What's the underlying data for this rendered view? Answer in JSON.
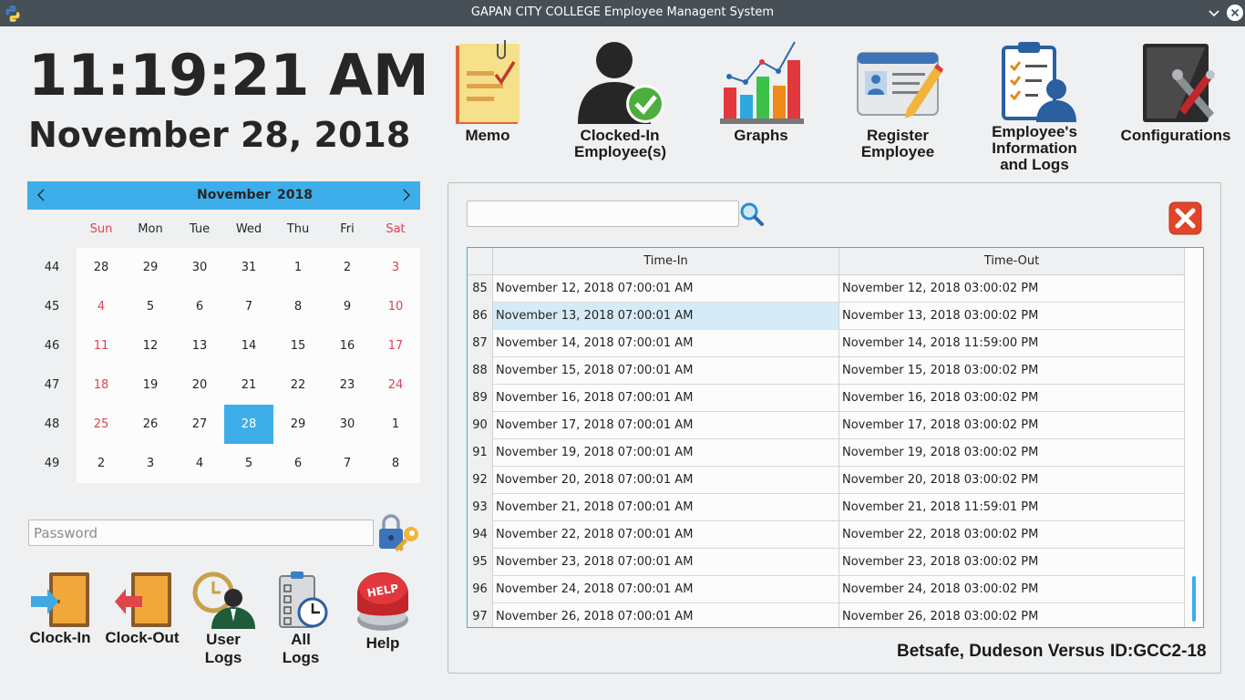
{
  "window": {
    "title": "GAPAN CITY COLLEGE Employee Managent System"
  },
  "clock": {
    "time": "11:19:21 AM",
    "date": "November 28, 2018"
  },
  "calendar": {
    "month": "November",
    "year": "2018",
    "dow": [
      "Sun",
      "Mon",
      "Tue",
      "Wed",
      "Thu",
      "Fri",
      "Sat"
    ],
    "weeks": [
      {
        "num": "44",
        "days": [
          "28",
          "29",
          "30",
          "31",
          "1",
          "2",
          "3"
        ]
      },
      {
        "num": "45",
        "days": [
          "4",
          "5",
          "6",
          "7",
          "8",
          "9",
          "10"
        ]
      },
      {
        "num": "46",
        "days": [
          "11",
          "12",
          "13",
          "14",
          "15",
          "16",
          "17"
        ]
      },
      {
        "num": "47",
        "days": [
          "18",
          "19",
          "20",
          "21",
          "22",
          "23",
          "24"
        ]
      },
      {
        "num": "48",
        "days": [
          "25",
          "26",
          "27",
          "28",
          "29",
          "30",
          "1"
        ]
      },
      {
        "num": "49",
        "days": [
          "2",
          "3",
          "4",
          "5",
          "6",
          "7",
          "8"
        ]
      }
    ],
    "selected_day": "28"
  },
  "password": {
    "placeholder": "Password"
  },
  "bottom_buttons": {
    "clock_in": "Clock-In",
    "clock_out": "Clock-Out",
    "user_logs_1": "User",
    "user_logs_2": "Logs",
    "all_logs_1": "All",
    "all_logs_2": "Logs",
    "help": "Help"
  },
  "toolbar": {
    "memo": "Memo",
    "clocked_in_1": "Clocked-In",
    "clocked_in_2": "Employee(s)",
    "graphs": "Graphs",
    "register_1": "Register",
    "register_2": "Employee",
    "info_1": "Employee's",
    "info_2": "Information",
    "info_3": "and Logs",
    "config": "Configurations"
  },
  "table": {
    "headers": [
      "Time-In",
      "Time-Out"
    ],
    "rows": [
      {
        "n": "85",
        "in": "November 12, 2018 07:00:01 AM",
        "out": "November 12, 2018 03:00:02 PM"
      },
      {
        "n": "86",
        "in": "November 13, 2018 07:00:01 AM",
        "out": "November 13, 2018 03:00:02 PM"
      },
      {
        "n": "87",
        "in": "November 14, 2018 07:00:01 AM",
        "out": "November 14, 2018 11:59:00 PM"
      },
      {
        "n": "88",
        "in": "November 15, 2018 07:00:01 AM",
        "out": "November 15, 2018 03:00:02 PM"
      },
      {
        "n": "89",
        "in": "November 16, 2018 07:00:01 AM",
        "out": "November 16, 2018 03:00:02 PM"
      },
      {
        "n": "90",
        "in": "November 17, 2018 07:00:01 AM",
        "out": "November 17, 2018 03:00:02 PM"
      },
      {
        "n": "91",
        "in": "November 19, 2018 07:00:01 AM",
        "out": "November 19, 2018 03:00:02 PM"
      },
      {
        "n": "92",
        "in": "November 20, 2018 07:00:01 AM",
        "out": "November 20, 2018 03:00:02 PM"
      },
      {
        "n": "93",
        "in": "November 21, 2018 07:00:01 AM",
        "out": "November 21, 2018 11:59:01 PM"
      },
      {
        "n": "94",
        "in": "November 22, 2018 07:00:01 AM",
        "out": "November 22, 2018 03:00:02 PM"
      },
      {
        "n": "95",
        "in": "November 23, 2018 07:00:01 AM",
        "out": "November 23, 2018 03:00:02 PM"
      },
      {
        "n": "96",
        "in": "November 24, 2018 07:00:01 AM",
        "out": "November 24, 2018 03:00:02 PM"
      },
      {
        "n": "97",
        "in": "November 26, 2018 07:00:01 AM",
        "out": "November 26, 2018 03:00:02 PM"
      }
    ],
    "selected_row": "86"
  },
  "employee": {
    "name": "Betsafe, Dudeson Versus",
    "id": "ID:GCC2-18"
  },
  "colors": {
    "accent": "#3daee9",
    "weekend": "#da4453",
    "titlebar": "#475057"
  }
}
